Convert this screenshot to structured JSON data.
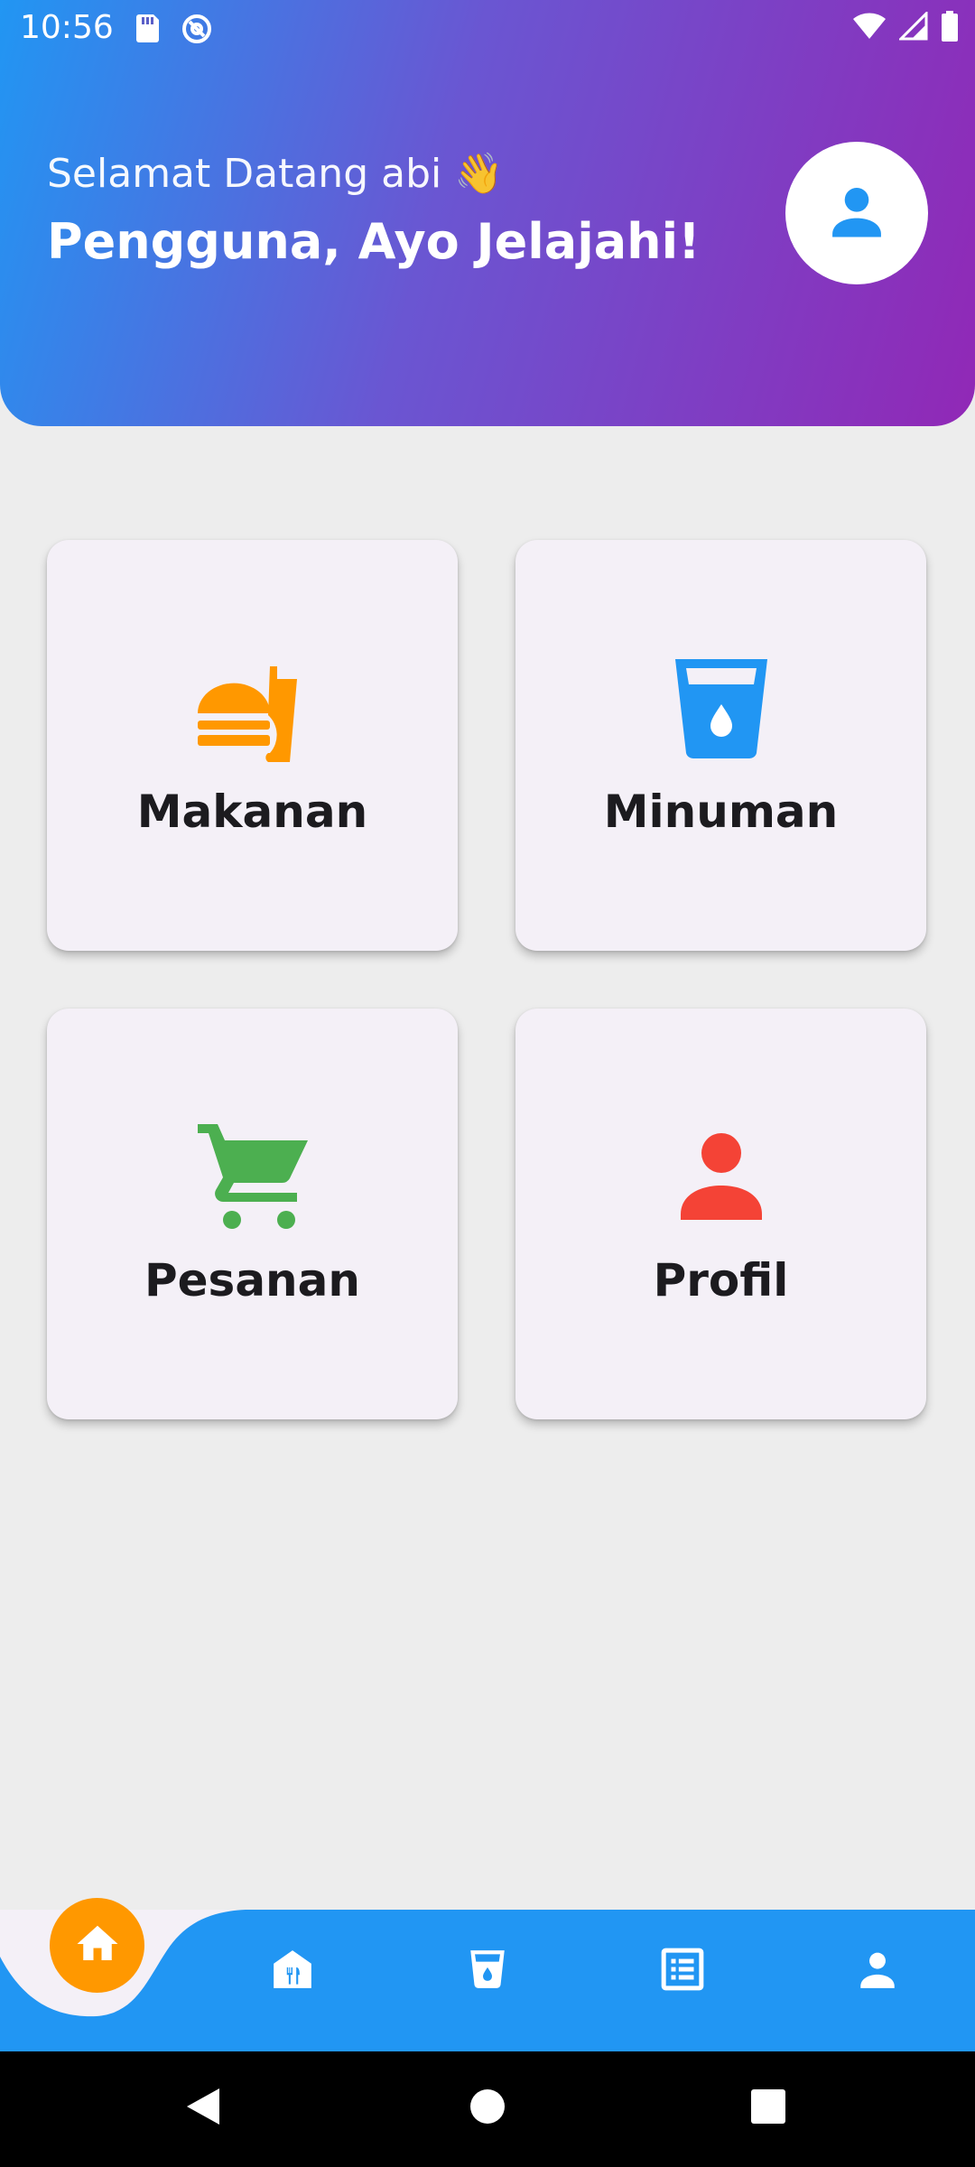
{
  "status_bar": {
    "time": "10:56",
    "icons": [
      "sd-card-icon",
      "data-saver-icon",
      "wifi-icon",
      "signal-icon",
      "battery-icon"
    ]
  },
  "header": {
    "greeting": "Selamat Datang abi 👋",
    "headline": "Pengguna, Ayo Jelajahi!",
    "avatar_icon": "person-icon"
  },
  "menu": {
    "items": [
      {
        "label": "Makanan",
        "icon": "fastfood-icon",
        "color": "#ff9800"
      },
      {
        "label": "Minuman",
        "icon": "drink-icon",
        "color": "#2196f3"
      },
      {
        "label": "Pesanan",
        "icon": "cart-icon",
        "color": "#4caf50"
      },
      {
        "label": "Profil",
        "icon": "person-icon",
        "color": "#f44336"
      }
    ]
  },
  "bottom_nav": {
    "background": "#2196f3",
    "active_color": "#ff9800",
    "items": [
      "home-icon",
      "restaurant-icon",
      "drink-icon",
      "list-icon",
      "person-icon"
    ],
    "active_index": 0
  },
  "system_nav": [
    "back-icon",
    "home-circle-icon",
    "recents-icon"
  ]
}
